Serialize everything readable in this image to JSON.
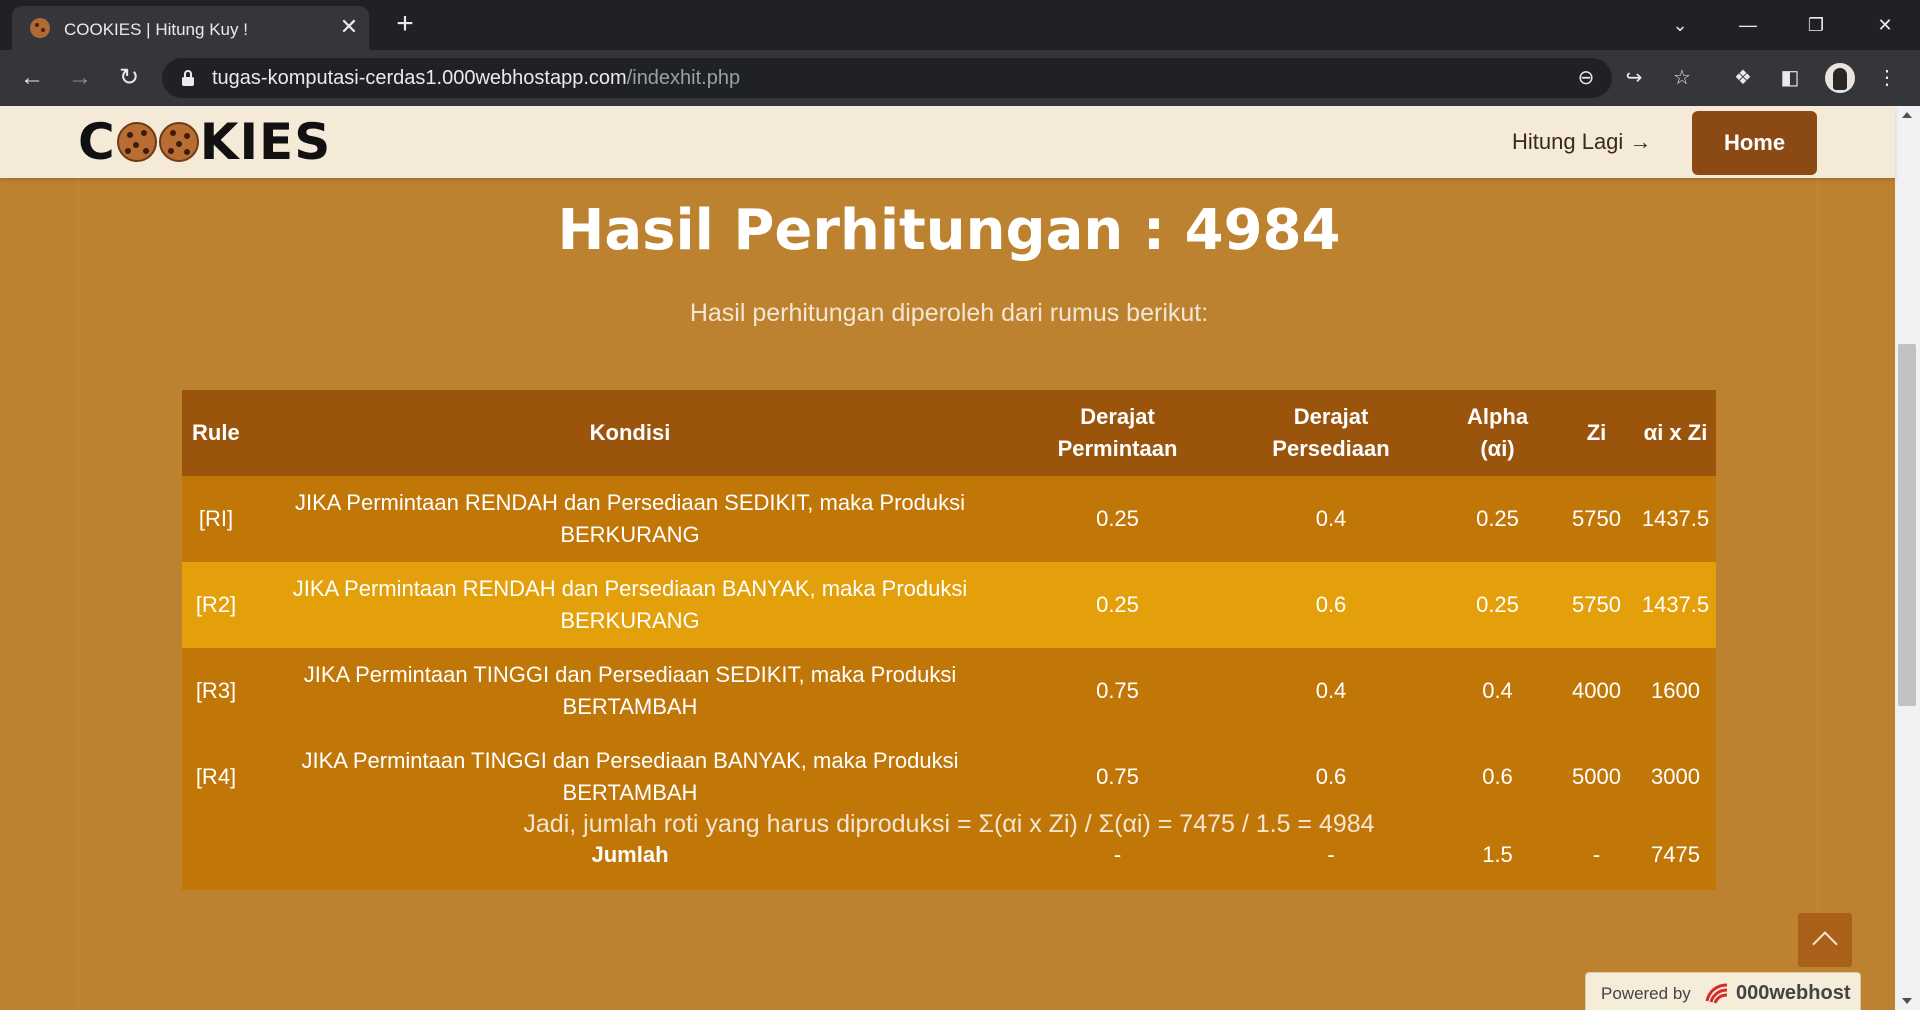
{
  "browser": {
    "tab_title": "COOKIES | Hitung Kuy !",
    "url_domain": "tugas-komputasi-cerdas1.000webhostapp.com",
    "url_path": "/indexhit.php"
  },
  "navbar": {
    "logo_left": "C",
    "logo_right": "KIES",
    "hitung_link": "Hitung Lagi →",
    "home_button": "Home"
  },
  "result": {
    "title": "Hasil Perhitungan : 4984",
    "subtitle": "Hasil perhitungan diperoleh dari rumus berikut:"
  },
  "table": {
    "headers": {
      "rule": "Rule",
      "kondisi": "Kondisi",
      "dpm_1": "Derajat",
      "dpm_2": "Permintaan",
      "dps_1": "Derajat",
      "dps_2": "Persediaan",
      "alpha_1": "Alpha",
      "alpha_2": "(αi)",
      "zi": "Zi",
      "azi": "αi x Zi"
    },
    "rows": [
      {
        "rule": "[RI]",
        "kondisi_1": "JIKA Permintaan RENDAH dan Persediaan SEDIKIT, maka Produksi",
        "kondisi_2": "BERKURANG",
        "dpm": "0.25",
        "dps": "0.4",
        "alpha": "0.25",
        "zi": "5750",
        "azi": "1437.5"
      },
      {
        "rule": "[R2]",
        "kondisi_1": "JIKA Permintaan RENDAH dan Persediaan BANYAK, maka Produksi",
        "kondisi_2": "BERKURANG",
        "dpm": "0.25",
        "dps": "0.6",
        "alpha": "0.25",
        "zi": "5750",
        "azi": "1437.5"
      },
      {
        "rule": "[R3]",
        "kondisi_1": "JIKA Permintaan TINGGI dan Persediaan SEDIKIT, maka Produksi",
        "kondisi_2": "BERTAMBAH",
        "dpm": "0.75",
        "dps": "0.4",
        "alpha": "0.4",
        "zi": "4000",
        "azi": "1600"
      },
      {
        "rule": "[R4]",
        "kondisi_1": "JIKA Permintaan TINGGI dan Persediaan BANYAK, maka Produksi",
        "kondisi_2": "BERTAMBAH",
        "dpm": "0.75",
        "dps": "0.6",
        "alpha": "0.6",
        "zi": "5000",
        "azi": "3000"
      }
    ],
    "total": {
      "label": "Jumlah",
      "dpm": "-",
      "dps": "-",
      "alpha": "1.5",
      "zi": "-",
      "azi": "7475"
    }
  },
  "conclusion": "Jadi, jumlah roti yang harus diproduksi = Σ(αi x Zi) / Σ(αi) = 7475 / 1.5 = 4984",
  "footer": {
    "powered_by": "Powered by",
    "brand": "000webhost"
  },
  "icons": {
    "tab_favicon": "cookie-icon",
    "back": "arrow-left-icon",
    "forward": "arrow-right-icon",
    "reload": "reload-icon",
    "lock": "lock-icon",
    "zoom": "zoom-out-icon",
    "share": "share-icon",
    "bookmark": "star-icon",
    "extensions": "puzzle-icon",
    "side_panel": "side-panel-icon",
    "menu": "kebab-menu-icon",
    "scroll_top": "chevron-up-icon"
  },
  "colors": {
    "page_bg": "#bc8230",
    "navbar_bg": "#f5e9d8",
    "home_btn": "#8b4a13",
    "table_header": "#9b540c",
    "table_row": "#c17708",
    "table_row_highlight": "#e3a00b"
  }
}
